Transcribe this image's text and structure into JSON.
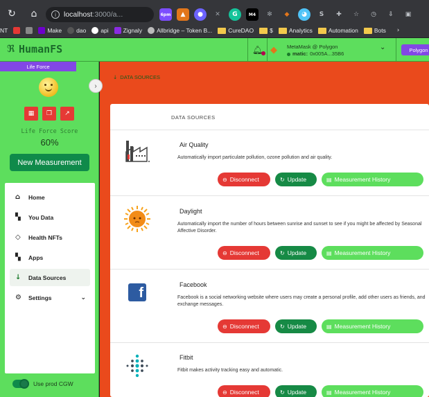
{
  "browser": {
    "address_host": "localhost",
    "address_rest": ":3000/a...",
    "badge_6pm": "6pm",
    "badge_m4": "M4"
  },
  "bookmarks": [
    {
      "label": "NT"
    },
    {
      "label": "Make"
    },
    {
      "label": "dao"
    },
    {
      "label": "api"
    },
    {
      "label": "Zignaly"
    },
    {
      "label": "Allbridge – Token B..."
    },
    {
      "label": "CureDAO"
    },
    {
      "label": "$"
    },
    {
      "label": "Analytics"
    },
    {
      "label": "Automation"
    },
    {
      "label": "Bots"
    }
  ],
  "header": {
    "app_name": "HumanFS",
    "wallet_name": "MetaMask @ Polygon",
    "wallet_network": "matic:",
    "wallet_address": "0x005A...35B6",
    "network_pill": "Polygon"
  },
  "sidebar": {
    "tag": "Life Force",
    "score_label": "Life Force Score",
    "score_value": "60%",
    "new_measurement": "New Measurement",
    "nav": [
      {
        "label": "Home",
        "icon": "home-icon"
      },
      {
        "label": "You Data",
        "icon": "grid-icon"
      },
      {
        "label": "Health NFTs",
        "icon": "gem-icon"
      },
      {
        "label": "Apps",
        "icon": "apps-icon"
      },
      {
        "label": "Data Sources",
        "icon": "arrow-down-icon",
        "active": true
      },
      {
        "label": "Settings",
        "icon": "gear-icon"
      }
    ],
    "toggle_label": "Use prod CGW"
  },
  "main": {
    "breadcrumb": "DATA SOURCES",
    "card_title": "DATA SOURCES",
    "buttons": {
      "disconnect": "Disconnect",
      "update": "Update",
      "history": "Measurement History"
    },
    "sources": [
      {
        "name": "Air Quality",
        "description": "Automatically import particulate pollution, ozone pollution and air quality."
      },
      {
        "name": "Daylight",
        "description": "Automatically import the number of hours between sunrise and sunset to see if you might be affected by Seasonal Affective Disorder."
      },
      {
        "name": "Facebook",
        "description": "Facebook is a social networking website where users may create a personal profile, add other users as friends, and exchange messages."
      },
      {
        "name": "Fitbit",
        "description": "Fitbit makes activity tracking easy and automatic."
      }
    ]
  },
  "colors": {
    "app_green": "#5dde5d",
    "dark_green": "#0f8a4a",
    "orange": "#ea4a1c",
    "red": "#e53935",
    "purple": "#8247e5"
  }
}
